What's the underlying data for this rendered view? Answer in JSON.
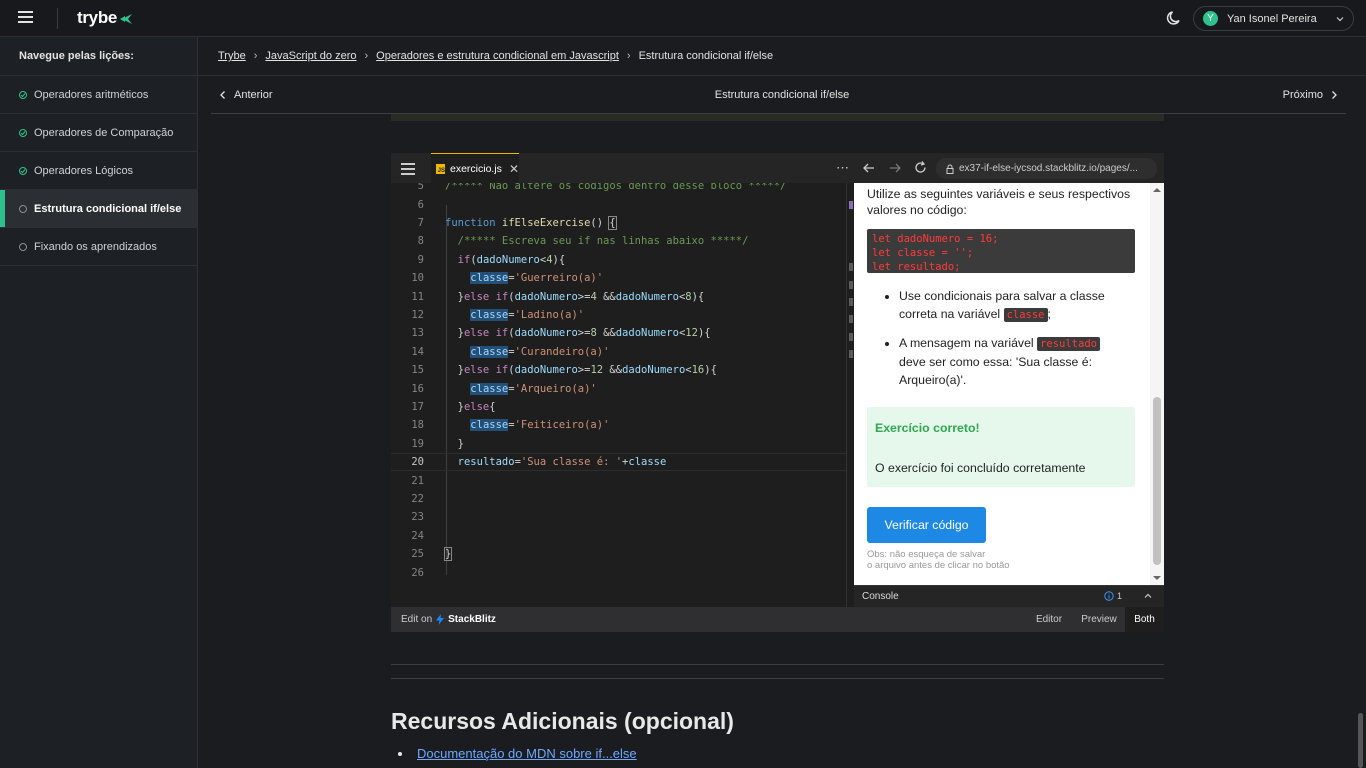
{
  "header": {
    "logo": "trybe",
    "user_initial": "Y",
    "user_name": "Yan Isonel Pereira"
  },
  "sidebar": {
    "title": "Navegue pelas lições:",
    "items": [
      {
        "label": "Operadores aritméticos",
        "done": true
      },
      {
        "label": "Operadores de Comparação",
        "done": true
      },
      {
        "label": "Operadores Lógicos",
        "done": true
      },
      {
        "label": "Estrutura condicional if/else",
        "done": false,
        "active": true
      },
      {
        "label": "Fixando os aprendizados",
        "done": false
      }
    ]
  },
  "breadcrumb": [
    "Trybe",
    "JavaScript do zero",
    "Operadores e estrutura condicional em Javascript",
    "Estrutura condicional if/else"
  ],
  "nav": {
    "prev": "Anterior",
    "title": "Estrutura condicional if/else",
    "next": "Próximo"
  },
  "stackblitz": {
    "tab": "exercicio.js",
    "url": "ex37-if-else-iycsod.stackblitz.io/pages/...",
    "line_numbers": [
      "5",
      "6",
      "7",
      "8",
      "9",
      "10",
      "11",
      "12",
      "13",
      "14",
      "15",
      "16",
      "17",
      "18",
      "19",
      "20",
      "21",
      "22",
      "23",
      "24",
      "25",
      "26"
    ],
    "current_line": "20",
    "edit_on": "Edit on",
    "brand": "StackBlitz",
    "view_buttons": [
      "Editor",
      "Preview",
      "Both"
    ],
    "console_label": "Console",
    "console_count": "1"
  },
  "preview": {
    "intro": "Utilize as seguintes variáveis e seus respectivos valores no código:",
    "code_lines": [
      "let dadoNumero = 16;",
      "let classe = '';",
      "let resultado;"
    ],
    "bullet1_a": "Use condicionais para salvar a classe correta na variável ",
    "bullet1_code": "classe",
    "bullet1_b": ";",
    "bullet2_a": "A mensagem na variável ",
    "bullet2_code": "resultado",
    "bullet2_b": " deve ser como essa: 'Sua classe é: Arqueiro(a)'.",
    "success_title": "Exercício correto!",
    "success_msg": "O exercício foi concluído corretamente",
    "verify_button": "Verificar código",
    "obs_line1": "Obs: não esqueça de salvar",
    "obs_line2": "o arquivo antes de clicar no botão"
  },
  "resources": {
    "heading": "Recursos Adicionais (opcional)",
    "link": "Documentação do MDN sobre if...else"
  },
  "colors": {
    "accent": "#2fc18c",
    "verify": "#1e88e5",
    "success_bg": "#e6f8ec"
  }
}
